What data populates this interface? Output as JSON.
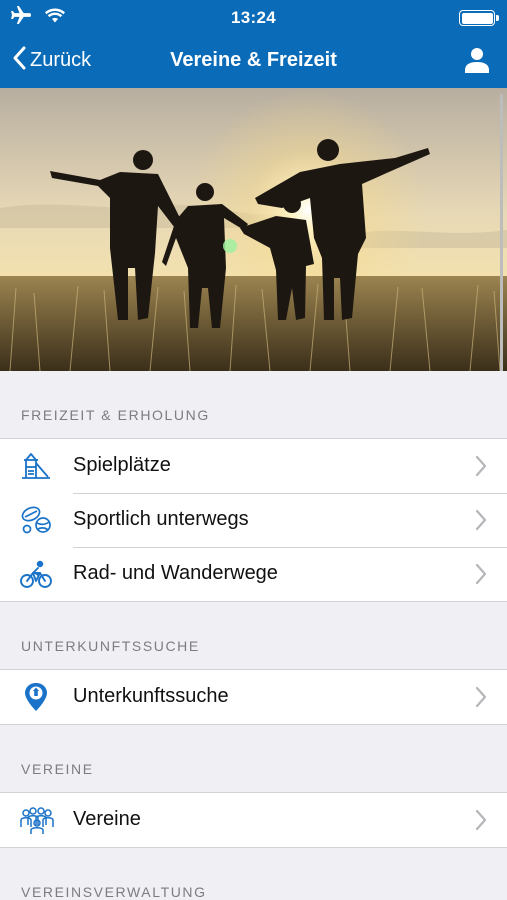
{
  "status_bar": {
    "time": "13:24",
    "left_icons": [
      "airplane-icon",
      "wifi-icon"
    ],
    "right_icons": [
      "battery-icon"
    ]
  },
  "nav": {
    "back_label": "Zurück",
    "title": "Vereine & Freizeit",
    "right_icon": "user-icon"
  },
  "hero": {
    "description_icon": "family-field-photo"
  },
  "sections": [
    {
      "header": "FREIZEIT & ERHOLUNG",
      "items": [
        {
          "label": "Spielplätze",
          "icon": "playground-icon"
        },
        {
          "label": "Sportlich unterwegs",
          "icon": "sports-balls-icon"
        },
        {
          "label": "Rad- und Wanderwege",
          "icon": "bicycle-icon"
        }
      ]
    },
    {
      "header": "UNTERKUNFTSSUCHE",
      "items": [
        {
          "label": "Unterkunftssuche",
          "icon": "location-pin-icon"
        }
      ]
    },
    {
      "header": "VEREINE",
      "items": [
        {
          "label": "Vereine",
          "icon": "group-icon"
        }
      ]
    },
    {
      "header": "VEREINSVERWALTUNG",
      "items": []
    }
  ],
  "colors": {
    "brand": "#0a6bb8",
    "icon_blue": "#1a73c8",
    "background": "#efeff4",
    "header_text": "#7d7d80"
  }
}
